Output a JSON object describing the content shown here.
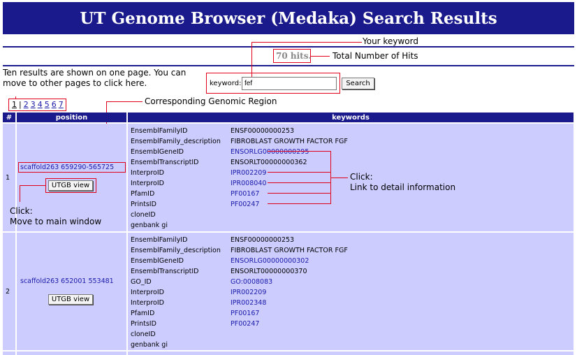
{
  "header": {
    "title": "UT Genome Browser (Medaka) Search Results"
  },
  "annotations": {
    "your_keyword": "Your keyword",
    "total_hits": "Total Number of Hits",
    "corresponding_region": "Corresponding Genomic Region",
    "ten_results": "Ten results are shown on one page. You can move to other pages to click here.",
    "click_detail_1": "Click:",
    "click_detail_2": "Link to detail information",
    "click_main_1": "Click:",
    "click_main_2": "Move to main window"
  },
  "hits": {
    "text": "70 hits."
  },
  "search": {
    "label": "keyword:",
    "value": "fef",
    "button": "Search"
  },
  "pagination": {
    "current": "1",
    "pages": [
      "2",
      "3",
      "4",
      "5",
      "6",
      "7"
    ]
  },
  "table": {
    "headers": {
      "num": "#",
      "position": "position",
      "keywords": "keywords"
    },
    "rows": [
      {
        "num": "1",
        "position": "scaffold263 659290-565725",
        "button": "UTGB view",
        "keywords": [
          {
            "key": "EnsemblFamilyID",
            "value": "ENSF00000000253",
            "link": false
          },
          {
            "key": "EnsemblFamily_description",
            "value": "FIBROBLAST GROWTH FACTOR FGF",
            "link": false
          },
          {
            "key": "EnsemblGeneID",
            "value": "ENSORLG00000000295",
            "link": true
          },
          {
            "key": "EnsemblTranscriptID",
            "value": "ENSORLT00000000362",
            "link": false
          },
          {
            "key": "InterproID",
            "value": "IPR002209",
            "link": true
          },
          {
            "key": "InterproID",
            "value": "IPR008040",
            "link": true
          },
          {
            "key": "PfamID",
            "value": "PF00167",
            "link": true
          },
          {
            "key": "PrintsID",
            "value": "PF00247",
            "link": true
          },
          {
            "key": "cloneID",
            "value": "",
            "link": false
          },
          {
            "key": "genbank gi",
            "value": "",
            "link": false
          }
        ]
      },
      {
        "num": "2",
        "position": "scaffold263 652001 553481",
        "button": "UTGB view",
        "keywords": [
          {
            "key": "EnsemblFamilyID",
            "value": "ENSF00000000253",
            "link": false
          },
          {
            "key": "EnsemblFamily_description",
            "value": "FIBROBLAST GROWTH FACTOR FGF",
            "link": false
          },
          {
            "key": "EnsemblGeneID",
            "value": "ENSORLG00000000302",
            "link": true
          },
          {
            "key": "EnsemblTranscriptID",
            "value": "ENSORLT00000000370",
            "link": false
          },
          {
            "key": "GO_ID",
            "value": "GO:0008083",
            "link": true
          },
          {
            "key": "InterproID",
            "value": "IPR002209",
            "link": true
          },
          {
            "key": "InterproID",
            "value": "IPR002348",
            "link": true
          },
          {
            "key": "PfamID",
            "value": "PF00167",
            "link": true
          },
          {
            "key": "PrintsID",
            "value": "PF00247",
            "link": true
          },
          {
            "key": "cloneID",
            "value": "",
            "link": false
          },
          {
            "key": "genbank gi",
            "value": "",
            "link": false
          }
        ]
      }
    ]
  }
}
